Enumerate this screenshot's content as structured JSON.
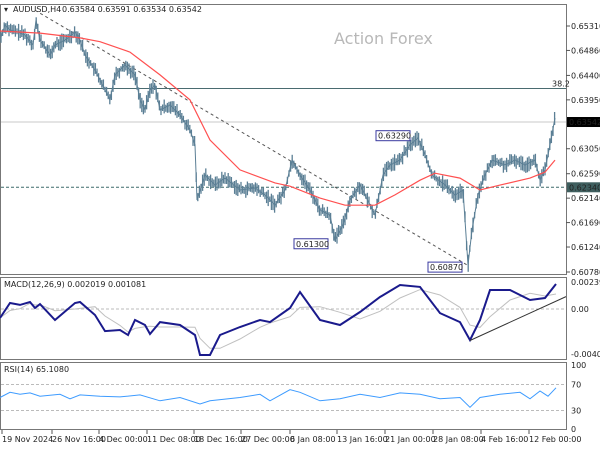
{
  "header": {
    "symbol": "AUDUSD,H4",
    "ohlc": "0.63584 0.63591 0.63534 0.63542"
  },
  "watermark": "Action Forex",
  "colors": {
    "candles": "#5b7f95",
    "ma": "#ff5050",
    "macd": "#1a1a8c",
    "signal": "#c0c0c0",
    "rsi": "#3d9bff",
    "grid": "#999999",
    "fib": "#4a6b70"
  },
  "chart_data": [
    {
      "type": "line",
      "title": "AUDUSD,H4",
      "ylim": [
        0.6078,
        0.6531
      ],
      "x_note": "bar position",
      "xlim": [
        0,
        566
      ],
      "ytick_values": [
        0.6531,
        0.6486,
        0.644,
        0.6395,
        0.6305,
        0.6259,
        0.6214,
        0.6169,
        0.6124,
        0.6078
      ],
      "ytick_labels": [
        "0.65310",
        "0.64860",
        "0.64400",
        "0.63950",
        "0.63050",
        "0.62590",
        "0.62140",
        "0.61690",
        "0.61240",
        "0.60780"
      ],
      "xtick_positions": [
        2,
        52,
        99,
        147,
        194,
        241,
        290,
        337,
        385,
        433,
        481,
        529
      ],
      "xtick_labels": [
        "19 Nov 2024",
        "26 Nov 16:00",
        "4 Dec 00:00",
        "11 Dec 08:00",
        "18 Dec 16:00",
        "27 Dec 00:00",
        "6 Jan 08:00",
        "13 Jan 16:00",
        "21 Jan 00:00",
        "28 Jan 08:00",
        "4 Feb 16:00",
        "12 Feb 00:00"
      ],
      "price": {
        "x": [
          0,
          5,
          10,
          18,
          25,
          33,
          36,
          40,
          50,
          55,
          65,
          75,
          80,
          85,
          95,
          100,
          110,
          115,
          125,
          130,
          135,
          140,
          145,
          150,
          155,
          160,
          170,
          180,
          190,
          195,
          197,
          205,
          215,
          225,
          240,
          255,
          265,
          275,
          285,
          292,
          300,
          310,
          320,
          330,
          335,
          343,
          350,
          360,
          370,
          375,
          383,
          390,
          400,
          410,
          418,
          425,
          432,
          445,
          455,
          463,
          468,
          472,
          478,
          485,
          492,
          505,
          515,
          525,
          535,
          540,
          545,
          550,
          555
        ],
        "close": [
          0.65052,
          0.65328,
          0.65236,
          0.652,
          0.65144,
          0.6496,
          0.6542,
          0.6505,
          0.64776,
          0.6496,
          0.6505,
          0.652,
          0.6505,
          0.64776,
          0.645,
          0.64316,
          0.6395,
          0.6441,
          0.64592,
          0.645,
          0.6441,
          0.6395,
          0.63763,
          0.6413,
          0.64224,
          0.63763,
          0.63855,
          0.6367,
          0.63395,
          0.6312,
          0.62106,
          0.62566,
          0.62382,
          0.62511,
          0.6229,
          0.62327,
          0.62198,
          0.62014,
          0.6229,
          0.62842,
          0.62566,
          0.6229,
          0.61921,
          0.6183,
          0.6137,
          0.61646,
          0.62106,
          0.62382,
          0.62014,
          0.6183,
          0.62566,
          0.6275,
          0.62842,
          0.6312,
          0.63248,
          0.62935,
          0.62566,
          0.62382,
          0.62198,
          0.6229,
          0.6091,
          0.61554,
          0.62198,
          0.62566,
          0.62842,
          0.6275,
          0.62842,
          0.6275,
          0.62842,
          0.62474,
          0.6266,
          0.6312,
          0.63615
        ]
      },
      "moving_average": {
        "x": [
          0,
          40,
          80,
          100,
          130,
          160,
          190,
          210,
          240,
          275,
          290,
          320,
          345,
          375,
          395,
          420,
          435,
          460,
          480,
          500,
          530,
          545,
          555
        ],
        "y": [
          0.65218,
          0.6518,
          0.6509,
          0.6502,
          0.6483,
          0.6441,
          0.6395,
          0.6321,
          0.6266,
          0.6242,
          0.6236,
          0.6214,
          0.6201,
          0.6201,
          0.622,
          0.6247,
          0.626,
          0.6251,
          0.6229,
          0.6238,
          0.6251,
          0.6262,
          0.6284
        ]
      },
      "trendline": {
        "x": [
          35,
          468
        ],
        "y": [
          0.656,
          0.609
        ]
      },
      "levels": [
        {
          "name": "fib-38-2",
          "price": 0.6416,
          "label": "38.2"
        },
        {
          "name": "current-price",
          "price": 0.63542,
          "label": "0.63542"
        },
        {
          "name": "support",
          "price": 0.6234,
          "label": "0.62340"
        }
      ],
      "annotations": [
        {
          "text": "0.63290",
          "x": 376,
          "price": 0.6329
        },
        {
          "text": "0.61300",
          "x": 294,
          "price": 0.613
        },
        {
          "text": "0.60870",
          "x": 428,
          "price": 0.6087
        }
      ]
    },
    {
      "type": "line",
      "title": "MACD(12,26,9) 0.002019 0.001081",
      "ylim": [
        -0.004021,
        0.002399
      ],
      "ytick_labels": [
        "0.002399",
        "0.00",
        "-0.004021"
      ],
      "x": [
        0,
        10,
        20,
        30,
        35,
        40,
        55,
        75,
        80,
        95,
        105,
        120,
        128,
        135,
        145,
        150,
        160,
        180,
        195,
        200,
        210,
        220,
        240,
        260,
        270,
        290,
        300,
        320,
        340,
        360,
        380,
        400,
        420,
        440,
        460,
        470,
        480,
        490,
        510,
        530,
        545,
        556
      ],
      "macd": [
        -0.0008,
        0.00053,
        0.00036,
        0.00062,
        9e-05,
        0.00044,
        -0.00098,
        0.00053,
        0.00062,
        -0.00053,
        -0.00196,
        -0.00187,
        -0.00231,
        -0.00098,
        -0.00142,
        -0.00222,
        -0.00116,
        -0.00142,
        -0.00231,
        -0.00409,
        -0.00409,
        -0.00231,
        -0.0016,
        -0.00098,
        -0.00116,
        9e-05,
        0.00151,
        -0.00098,
        -0.00142,
        -0.00027,
        0.00107,
        0.00213,
        0.00196,
        -0.00036,
        -0.00116,
        -0.00276,
        -0.00098,
        0.00169,
        0.00169,
        0.0008,
        0.00098,
        0.00222
      ],
      "trendline": {
        "x": [
          470,
          566
        ],
        "y": [
          -0.0028,
          0.0011
        ]
      }
    },
    {
      "type": "line",
      "title": "RSI(14) 65.1080",
      "ylim": [
        0,
        100
      ],
      "ytick_labels": [
        "100",
        "70",
        "30",
        "0"
      ],
      "x": [
        0,
        10,
        20,
        30,
        40,
        60,
        70,
        80,
        100,
        120,
        140,
        160,
        180,
        200,
        210,
        240,
        260,
        270,
        290,
        300,
        320,
        340,
        360,
        380,
        400,
        420,
        440,
        460,
        470,
        480,
        500,
        520,
        530,
        540,
        548,
        556
      ],
      "rsi": [
        50,
        58,
        55,
        57,
        52,
        55,
        48,
        54,
        52,
        51,
        54,
        45,
        50,
        40,
        45,
        50,
        55,
        45,
        62,
        58,
        45,
        48,
        55,
        50,
        57,
        55,
        48,
        50,
        35,
        50,
        55,
        58,
        48,
        60,
        52,
        65
      ]
    }
  ]
}
